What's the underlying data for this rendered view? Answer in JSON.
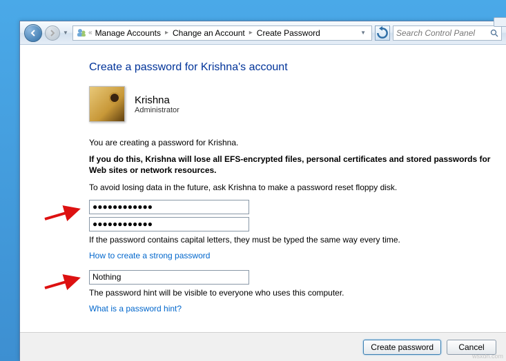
{
  "nav": {
    "breadcrumb": [
      "Manage Accounts",
      "Change an Account",
      "Create Password"
    ],
    "search_placeholder": "Search Control Panel"
  },
  "page": {
    "title": "Create a password for Krishna's account",
    "user_name": "Krishna",
    "user_role": "Administrator",
    "intro": "You are creating a password for Krishna.",
    "warning": "If you do this, Krishna will lose all EFS-encrypted files, personal certificates and stored passwords for Web sites or network resources.",
    "tip": "To avoid losing data in the future, ask Krishna to make a password reset floppy disk.",
    "password_value": "●●●●●●●●●●●●",
    "confirm_value": "●●●●●●●●●●●●",
    "caps_note": "If the password contains capital letters, they must be typed the same way every time.",
    "link_strong": "How to create a strong password",
    "hint_value": "Nothing",
    "hint_note": "The password hint will be visible to everyone who uses this computer.",
    "link_hint": "What is a password hint?"
  },
  "buttons": {
    "create": "Create password",
    "cancel": "Cancel"
  },
  "watermark": "wsxdn.com"
}
